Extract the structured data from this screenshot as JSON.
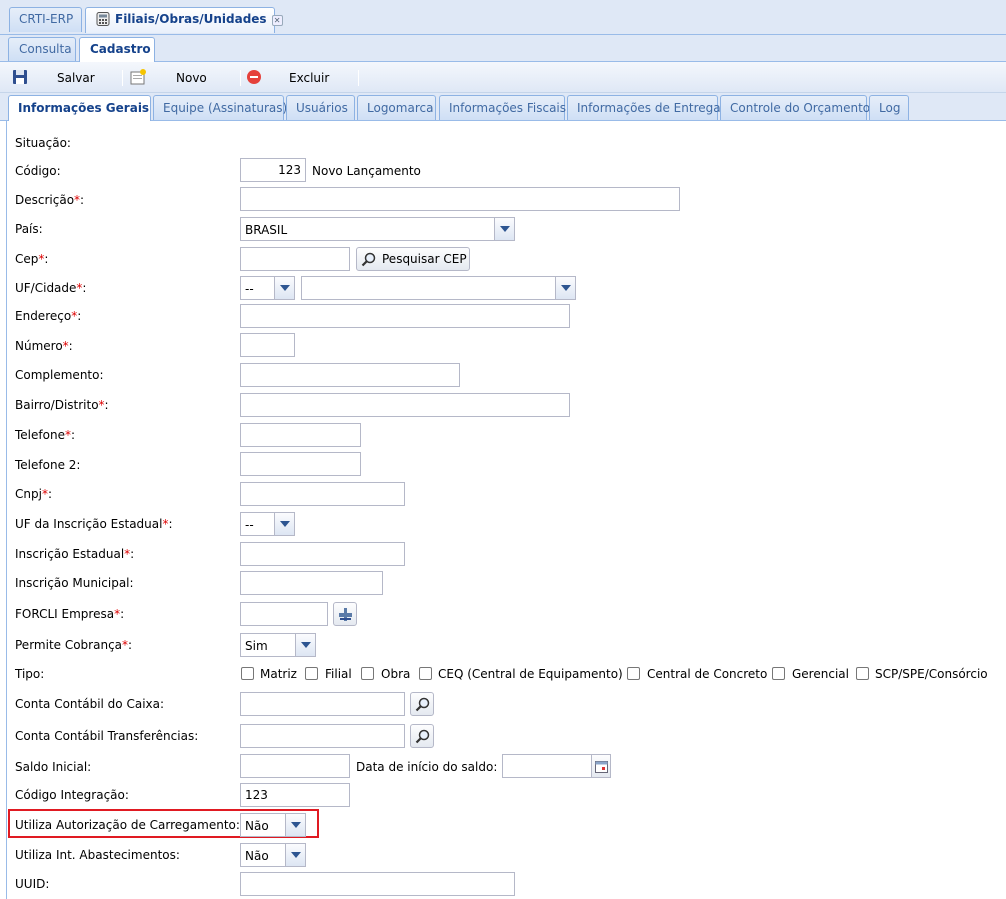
{
  "window_tabs": [
    {
      "label": "CRTI-ERP"
    },
    {
      "label": "Filiais/Obras/Unidades"
    }
  ],
  "sub_tabs": [
    {
      "label": "Consulta"
    },
    {
      "label": "Cadastro"
    }
  ],
  "toolbar": {
    "save_label": "Salvar",
    "new_label": "Novo",
    "delete_label": "Excluir"
  },
  "inner_tabs": [
    {
      "label": "Informações Gerais"
    },
    {
      "label": "Equipe (Assinaturas)"
    },
    {
      "label": "Usuários"
    },
    {
      "label": "Logomarca"
    },
    {
      "label": "Informações Fiscais"
    },
    {
      "label": "Informações de Entrega"
    },
    {
      "label": "Controle do Orçamento"
    },
    {
      "label": "Log"
    }
  ],
  "form": {
    "situacao_label": "Situação:",
    "codigo_label": "Código:",
    "codigo_value": "123",
    "codigo_status": "Novo Lançamento",
    "descricao_label": "Descrição",
    "pais_label": "País:",
    "pais_value": "BRASIL",
    "cep_label": "Cep",
    "cep_button": "Pesquisar CEP",
    "uf_cidade_label": "UF/Cidade",
    "uf_value": "--",
    "cidade_value": "",
    "endereco_label": "Endereço",
    "numero_label": "Número",
    "complemento_label": "Complemento:",
    "bairro_label": "Bairro/Distrito",
    "telefone_label": "Telefone",
    "telefone2_label": "Telefone 2:",
    "cnpj_label": "Cnpj",
    "uf_ie_label": "UF da Inscrição Estadual",
    "uf_ie_value": "--",
    "ie_label": "Inscrição Estadual",
    "im_label": "Inscrição Municipal:",
    "forcli_label": "FORCLI Empresa",
    "cobranca_label": "Permite Cobrança",
    "cobranca_value": "Sim",
    "tipo_label": "Tipo:",
    "tipo_options": [
      "Matriz",
      "Filial",
      "Obra",
      "CEQ (Central de Equipamento)",
      "Central de Concreto",
      "Gerencial",
      "SCP/SPE/Consórcio"
    ],
    "conta_caixa_label": "Conta Contábil do Caixa:",
    "conta_transf_label": "Conta Contábil Transferências:",
    "saldo_label": "Saldo Inicial:",
    "data_saldo_label": "Data de início do saldo:",
    "codigo_integracao_label": "Código Integração:",
    "codigo_integracao_value": "123",
    "autorizacao_label": "Utiliza Autorização de Carregamento:",
    "autorizacao_value": "Não",
    "abastecimentos_label": "Utiliza Int. Abastecimentos:",
    "abastecimentos_value": "Não",
    "uuid_label": "UUID:",
    "required_mark": "*",
    "colon": ":"
  },
  "colors": {
    "highlight": "#e01a22",
    "tab_text": "#15428b",
    "required": "#dd0000"
  }
}
